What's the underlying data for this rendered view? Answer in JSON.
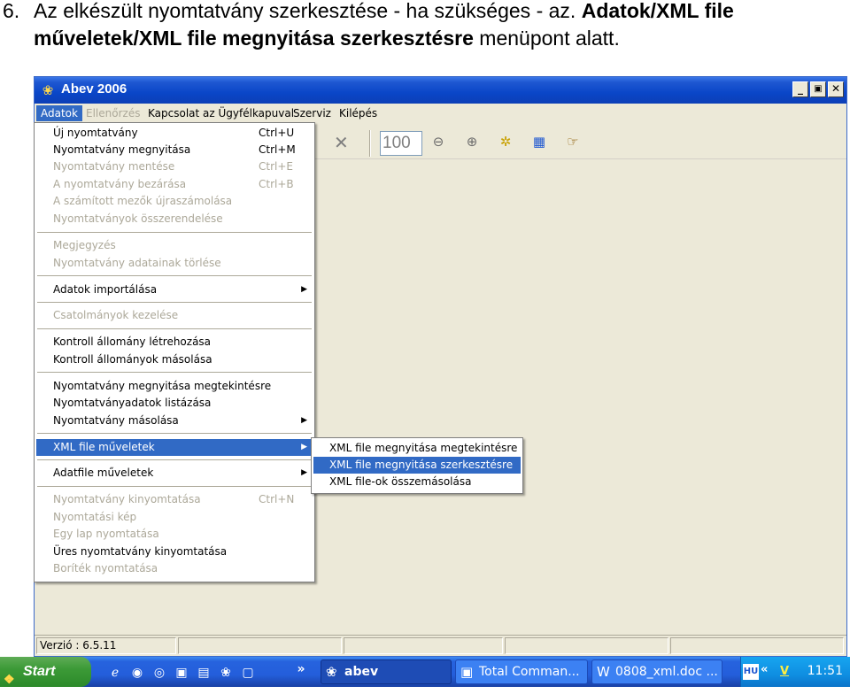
{
  "instruction": {
    "number": "6.",
    "line1_plain": "Az elkészült nyomtatvány szerkesztése - ha szükséges - az. ",
    "line1_bold": "Adatok/XML file",
    "line2_bold": "műveletek/XML file megnyitása szerkesztésre",
    "line2_plain": " menüpont alatt."
  },
  "window": {
    "title": "Abev 2006",
    "buttons": {
      "minimize": "_",
      "restore": "🗗",
      "close": "✕"
    }
  },
  "menubar": {
    "items": [
      {
        "label": "Adatok",
        "state": "active"
      },
      {
        "label": "Ellenőrzés",
        "state": "disabled"
      },
      {
        "label": "Kapcsolat az Ügyfélkapuval",
        "state": "normal"
      },
      {
        "label": "Szerviz",
        "state": "normal"
      },
      {
        "label": "Kilépés",
        "state": "normal"
      }
    ]
  },
  "toolbar": {
    "zoom_value": "100",
    "icons": [
      "close-x-icon",
      "zoom-out-icon",
      "zoom-in-icon",
      "settings-icon",
      "calculator-icon",
      "pointer-hand-icon"
    ]
  },
  "adatok_menu": {
    "items": [
      {
        "label": "Új nyomtatvány",
        "shortcut": "Ctrl+U"
      },
      {
        "label": "Nyomtatvány megnyitása",
        "shortcut": "Ctrl+M"
      },
      {
        "label": "Nyomtatvány mentése",
        "shortcut": "Ctrl+E"
      },
      {
        "label": "A nyomtatvány bezárása",
        "shortcut": "Ctrl+B"
      },
      {
        "label": "A számított mezők újraszámolása",
        "shortcut": ""
      },
      {
        "label": "Nyomtatványok összerendelése",
        "shortcut": ""
      },
      {
        "label": "Megjegyzés",
        "shortcut": ""
      },
      {
        "label": "Nyomtatvány adatainak törlése",
        "shortcut": ""
      },
      {
        "label": "Adatok importálása",
        "shortcut": ""
      },
      {
        "label": "Csatolmányok kezelése",
        "shortcut": ""
      },
      {
        "label": "Kontroll állomány létrehozása",
        "shortcut": ""
      },
      {
        "label": "Kontroll állományok másolása",
        "shortcut": ""
      },
      {
        "label": "Nyomtatvány megnyitása megtekintésre",
        "shortcut": ""
      },
      {
        "label": "Nyomtatványadatok listázása",
        "shortcut": ""
      },
      {
        "label": "Nyomtatvány másolása",
        "shortcut": ""
      },
      {
        "label": "XML file műveletek",
        "shortcut": ""
      },
      {
        "label": "Adatfile műveletek",
        "shortcut": ""
      },
      {
        "label": "Nyomtatvány kinyomtatása",
        "shortcut": "Ctrl+N"
      },
      {
        "label": "Nyomtatási kép",
        "shortcut": ""
      },
      {
        "label": "Egy lap nyomtatása",
        "shortcut": ""
      },
      {
        "label": "Üres nyomtatvány kinyomtatása",
        "shortcut": ""
      },
      {
        "label": "Boríték nyomtatása",
        "shortcut": ""
      }
    ]
  },
  "xml_submenu": {
    "items": [
      {
        "label": "XML file megnyitása megtekintésre"
      },
      {
        "label": "XML file megnyitása szerkesztésre"
      },
      {
        "label": "XML file-ok összemásolása"
      }
    ]
  },
  "statusbar": {
    "version": "Verzió : 6.5.11"
  },
  "taskbar": {
    "start_label": "Start",
    "overflow": "»",
    "tasks": [
      {
        "label": "abev",
        "icon": "abev-icon"
      },
      {
        "label": "Total Comman...",
        "icon": "floppy-icon"
      },
      {
        "label": "0808_xml.doc ...",
        "icon": "word-doc-icon"
      }
    ],
    "tray_chevron": "«",
    "tray_icons": [
      "HU",
      "V"
    ],
    "clock": "11:51"
  }
}
